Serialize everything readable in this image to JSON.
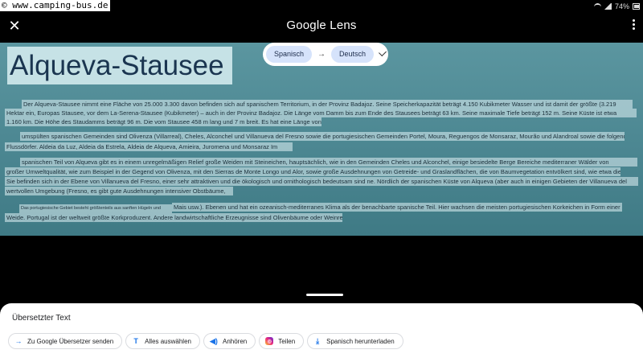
{
  "watermark": "© www.camping-bus.de",
  "status_bar": {
    "battery": "74%"
  },
  "header": {
    "title": "Google Lens",
    "close_icon": "close-icon",
    "menu_icon": "more-vert-icon"
  },
  "translation": {
    "source_lang": "Spanisch",
    "target_lang": "Deutsch",
    "arrow": "→"
  },
  "image": {
    "heading": "Alqueva-Stausee",
    "lines": [
      "Der Alqueva-Stausee nimmt eine Fläche von 25.000 3.300 davon befinden sich auf spanischem Territorium, in der Provinz Badajoz. Seine Speicherkapazität beträgt 4.150 Kubikmeter Wasser und ist damit der größte (3.219",
      "Hektar ein, Europas Stausee, vor dem La-Serena-Stausee (Kubikmeter) – auch in der Provinz Badajoz. Die Länge vom Damm bis zum Ende des Stausees beträgt 63 km. Seine maximale Tiefe beträgt 152 m. Seine Küste ist etwa",
      "1.160 km. Die Höhe des Staudamms beträgt 96 m. Die vom Stausee 458 m lang und 7 m breit. Es hat eine Länge von",
      "umspülten spanischen Gemeinden sind Olivenza (Villarreal), Cheles, Alconchel und Villanueva del Fresno sowie die portugiesischen Gemeinden Portel, Moura, Reguengos de Monsaraz, Mourão und Alandroal sowie die folgenden",
      "Flussdörfer. Aldeia da Luz, Aldeia da Estrela, Aldeia de Alqueva, Amieira, Juromena und Monsaraz Im",
      "spanischen Teil von Alqueva gibt es in einem unregelmäßigen Relief große Weiden mit Steineichen, hauptsächlich, wie in den Gemeinden Cheles und Alconchel, einige besiedelte Berge Bereiche mediterraner Wälder von",
      "großer Umweltqualität, wie zum Beispiel in der Gegend von Olivenza, mit den Sierras de Monte Longo und Alor, sowie große Ausdehnungen von Getreide- und Graslandflächen, die von Baumvegetation entvölkert sind, wie etwa diejenigen,",
      "Sie befinden sich in der Ebene von Villanueva del Fresno, einer sehr attraktiven und die ökologisch und ornithologisch bedeutsam sind ne. Nördlich der spanischen Küste von Alqueva (aber auch in einigen Gebieten der Villanueva del",
      "wertvollen Umgebung (Fresno, es gibt gute Ausdehnungen intensiver Obstbäume,",
      "Das portugiesische Gebiet besteht größtenteils aus sanften Hügeln und",
      "Mais usw.). Ebenen und hat ein ozeanisch-mediterranes Klima als der benachbarte spanische Teil. Hier wachsen die meisten portugiesischen Korkeichen in Form einer",
      "Weide. Portugal ist der weltweit größte Korkproduzent. Andere landwirtschaftliche Erzeugnisse sind Olivenbäume oder Weinreben."
    ]
  },
  "sheet": {
    "title": "Übersetzter Text",
    "actions": [
      {
        "label": "Zu Google Übersetzer senden",
        "icon": "arrow-right-icon"
      },
      {
        "label": "Alles auswählen",
        "icon": "text-select-icon"
      },
      {
        "label": "Anhören",
        "icon": "speaker-icon"
      },
      {
        "label": "Teilen",
        "icon": "instagram-icon"
      },
      {
        "label": "Spanisch herunterladen",
        "icon": "download-icon"
      }
    ]
  }
}
